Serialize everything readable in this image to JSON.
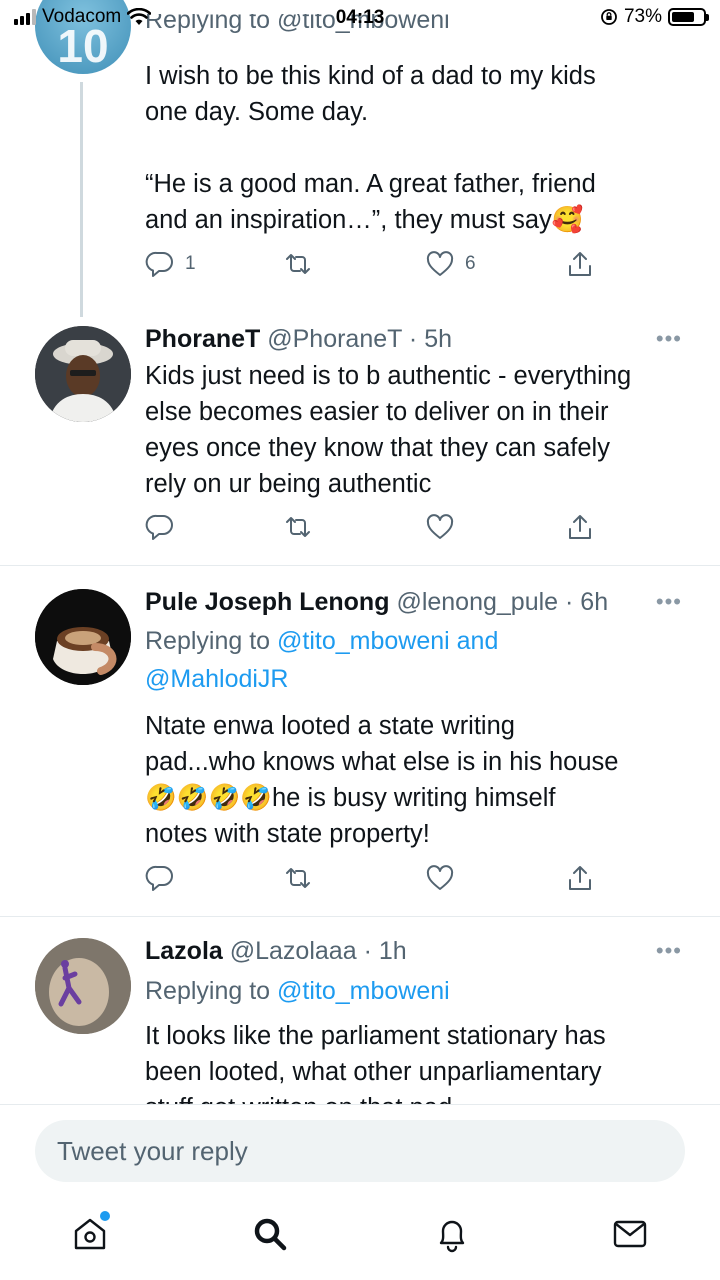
{
  "status_bar": {
    "carrier": "Vodacom",
    "time": "04:13",
    "battery_percent": "73%",
    "battery_level": 0.73
  },
  "tweets": [
    {
      "reply_partial": "Replying to @tito_mboweni",
      "text_lines": [
        "I wish to be this kind of a dad to my kids",
        "one day. Some day.",
        "",
        "“He is a good man. A great father, friend",
        "and an inspiration…”, they must say🥰"
      ],
      "reply_count": "1",
      "like_count": "6"
    },
    {
      "name": "PhoraneT",
      "handle": "@PhoraneT",
      "time": "· 5h",
      "more": "•••",
      "text_lines": [
        "Kids just need is to b authentic - everything",
        "else becomes easier to deliver on in their",
        "eyes once they know that they can safely",
        "rely on ur being authentic"
      ]
    },
    {
      "name": "Pule Joseph Lenong",
      "handle": "@lenong_pule",
      "time": "· 6h",
      "more": "•••",
      "replying_prefix": "Replying to",
      "mention_1": "@tito_mboweni and",
      "mention_2": "@MahlodiJR",
      "text_lines": [
        "Ntate enwa looted a state writing",
        "pad...who knows what else is in his house",
        "🤣🤣🤣🤣he is busy writing himself",
        "notes with state property!"
      ]
    },
    {
      "name": "Lazola",
      "handle": "@Lazolaaa",
      "time": "· 1h",
      "more": "•••",
      "replying_prefix": "Replying to",
      "mention_1": "@tito_mboweni",
      "text_lines": [
        "It looks like the parliament stationary has",
        "been looted, what other unparliamentary",
        "stuff got written on that pad"
      ]
    }
  ],
  "composer": {
    "placeholder": "Tweet your reply"
  },
  "icons": {
    "tabs": [
      "home-icon",
      "search-icon",
      "notifications-icon",
      "messages-icon"
    ],
    "actions": [
      "reply-icon",
      "retweet-icon",
      "like-icon",
      "share-icon"
    ]
  },
  "colors": {
    "accent": "#1d9bf0",
    "secondary_text": "#536471",
    "divider": "#e6ebee"
  }
}
